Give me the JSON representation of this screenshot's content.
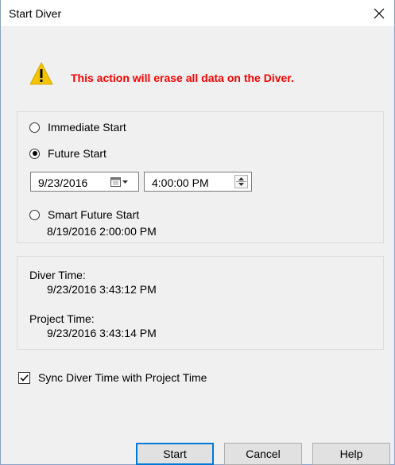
{
  "window": {
    "title": "Start Diver"
  },
  "warning": {
    "icon": "warning-icon",
    "message": "This action will erase all data on the Diver."
  },
  "start_options": {
    "immediate_label": "Immediate Start",
    "future_label": "Future Start",
    "future_date": "9/23/2016",
    "future_time": "4:00:00 PM",
    "smart_label": "Smart Future Start",
    "smart_value": "8/19/2016 2:00:00 PM",
    "selected": "Future Start"
  },
  "times": {
    "diver_label": "Diver Time:",
    "diver_value": "9/23/2016 3:43:12 PM",
    "project_label": "Project Time:",
    "project_value": "9/23/2016 3:43:14 PM"
  },
  "sync": {
    "label": "Sync Diver Time with Project Time",
    "checked": true
  },
  "buttons": {
    "start": "Start",
    "cancel": "Cancel",
    "help": "Help"
  },
  "colors": {
    "warning_text": "#ff0000",
    "warning_icon": "#f5c400",
    "default_button_border": "#0078d7"
  }
}
